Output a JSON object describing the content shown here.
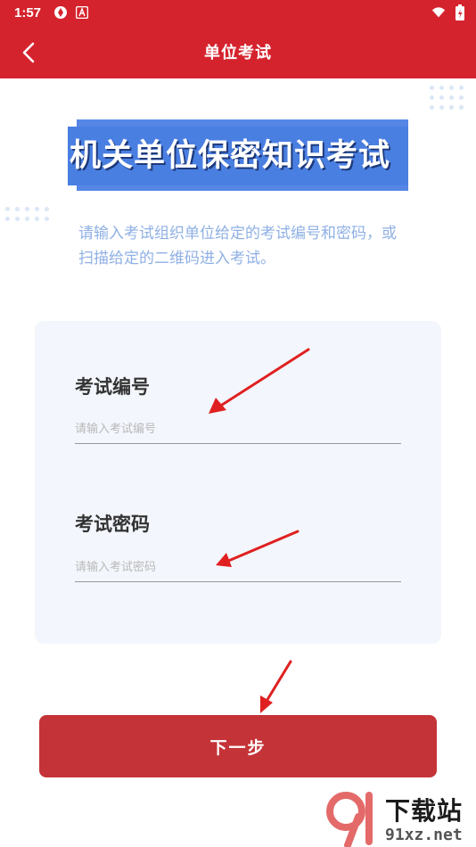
{
  "status_bar": {
    "time": "1:57",
    "icons": [
      "app-notification-icon",
      "a-notification-icon",
      "wifi-icon",
      "battery-charging-icon"
    ]
  },
  "header": {
    "title": "单位考试",
    "back_icon": "chevron-left-icon",
    "background": "#d5232e"
  },
  "banner": {
    "text": "机关单位保密知识考试",
    "background": "#4a7fe2"
  },
  "intro": {
    "text": "请输入考试组织单位给定的考试编号和密码，或扫描给定的二维码进入考试。"
  },
  "form": {
    "exam_number": {
      "label": "考试编号",
      "placeholder": "请输入考试编号",
      "value": ""
    },
    "exam_password": {
      "label": "考试密码",
      "placeholder": "请输入考试密码",
      "value": ""
    }
  },
  "next_button": {
    "label": "下一步",
    "background": "#c43337"
  },
  "annotation": {
    "arrow_color": "#e02020"
  },
  "watermark": {
    "title": "下载站",
    "domain": "91xz.net"
  }
}
